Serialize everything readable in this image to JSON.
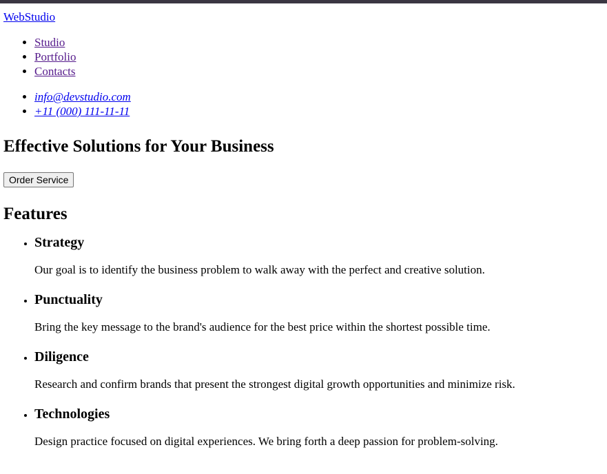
{
  "header": {
    "logo": "WebStudio",
    "nav": [
      "Studio",
      "Portfolio",
      "Contacts"
    ],
    "contacts": [
      "info@devstudio.com",
      "+11 (000) 111-11-11"
    ]
  },
  "hero": {
    "title": "Effective Solutions for Your Business",
    "button": "Order Service"
  },
  "features": {
    "title": "Features",
    "items": [
      {
        "title": "Strategy",
        "text": "Our goal is to identify the business problem to walk away with the perfect and creative solution."
      },
      {
        "title": "Punctuality",
        "text": "Bring the key message to the brand's audience for the best price within the shortest possible time."
      },
      {
        "title": "Diligence",
        "text": "Research and confirm brands that present the strongest digital growth opportunities and minimize risk."
      },
      {
        "title": "Technologies",
        "text": "Design practice focused on digital experiences. We bring forth a deep passion for problem-solving."
      }
    ]
  },
  "colors": {
    "topbar": "#3b3642",
    "link": "#0000ee",
    "visited_link": "#551a8b"
  }
}
